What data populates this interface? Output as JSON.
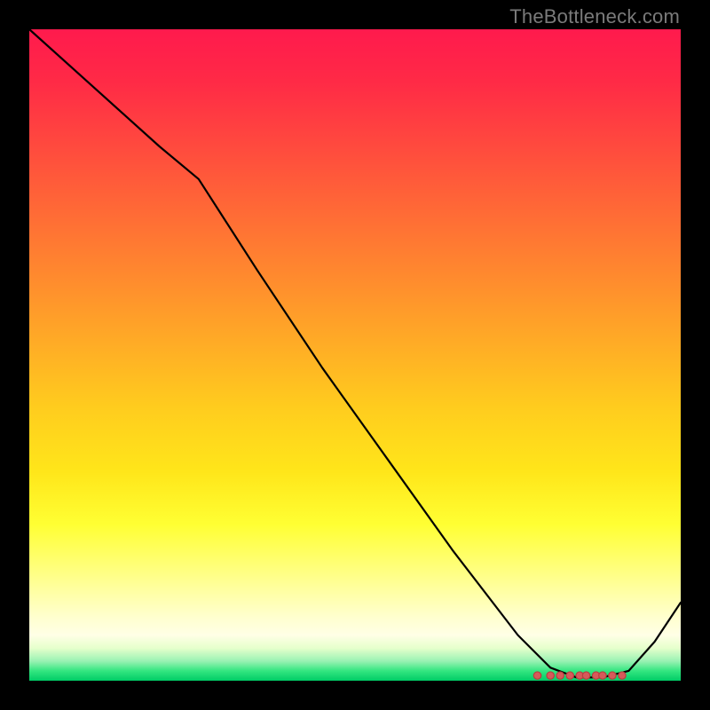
{
  "watermark": "TheBottleneck.com",
  "colors": {
    "background": "#000000",
    "gradient_top": "#ff1a4d",
    "gradient_bottom": "#00cc66",
    "curve": "#000000",
    "marker_fill": "#d65a5a",
    "marker_stroke": "#b73f3f"
  },
  "chart_data": {
    "type": "line",
    "title": "",
    "xlabel": "",
    "ylabel": "",
    "xlim": [
      0,
      100
    ],
    "ylim": [
      0,
      100
    ],
    "note": "Axes have no visible tick labels; x/y expressed as 0–100 relative to plot area, y=0 at bottom.",
    "series": [
      {
        "name": "curve",
        "x": [
          0,
          10,
          20,
          26,
          35,
          45,
          55,
          65,
          75,
          80,
          84,
          88,
          92,
          96,
          100
        ],
        "y": [
          100,
          91,
          82,
          77,
          63,
          48,
          34,
          20,
          7,
          2,
          0.5,
          0.5,
          1.5,
          6,
          12
        ]
      }
    ],
    "markers": {
      "name": "highlight-cluster",
      "x": [
        78,
        80,
        81.5,
        83,
        84.5,
        85.5,
        87,
        88,
        89.5,
        91
      ],
      "y": [
        0.8,
        0.8,
        0.8,
        0.8,
        0.8,
        0.8,
        0.8,
        0.8,
        0.8,
        0.8
      ],
      "r": 4.2
    }
  }
}
